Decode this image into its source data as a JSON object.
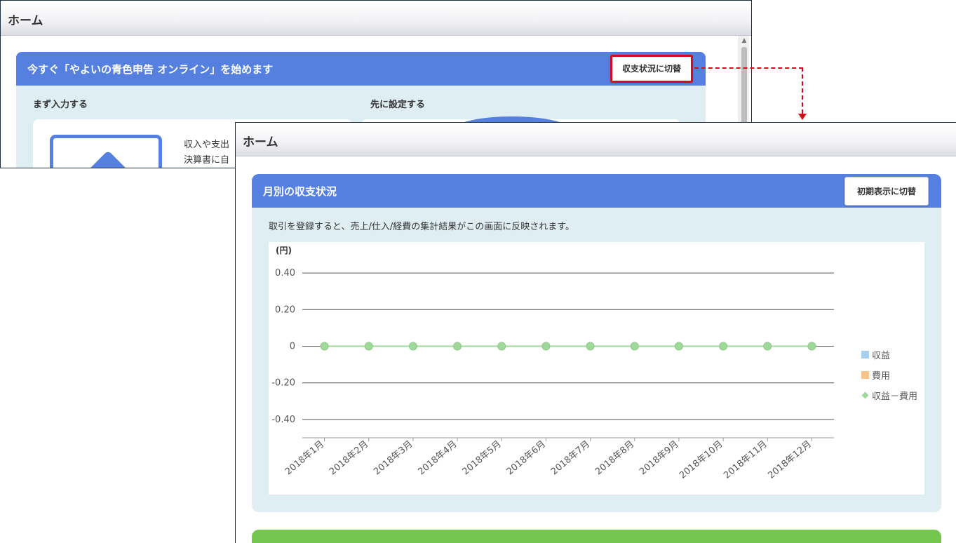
{
  "back_window": {
    "title": "ホーム",
    "card_title": "今すぐ「やよいの青色申告 オンライン」を始めます",
    "switch_label": "収支状況に切替",
    "left_subheading": "まず入力する",
    "right_subheading": "先に設定する",
    "text_line1": "収入や支出",
    "text_line2": "決算書に自"
  },
  "front_window": {
    "title": "ホーム",
    "card_title": "月別の収支状況",
    "switch_label": "初期表示に切替",
    "description": "取引を登録すると、売上/仕入/経費の集計結果がこの画面に反映されます。"
  },
  "colors": {
    "accent_blue": "#5580e0",
    "highlight_red": "#d60c1c",
    "panel_bg": "#deeef3",
    "green_card": "#75c64f",
    "line_green": "#9fd89a"
  },
  "chart_data": {
    "type": "line",
    "ylabel": "(円)",
    "ylim": [
      -0.5,
      0.5
    ],
    "yticks": [
      0.4,
      0.2,
      0,
      -0.2,
      -0.4
    ],
    "ytick_labels": [
      "0.40",
      "0.20",
      "0",
      "-0.20",
      "-0.40"
    ],
    "categories": [
      "2018年1月",
      "2018年2月",
      "2018年3月",
      "2018年4月",
      "2018年5月",
      "2018年6月",
      "2018年7月",
      "2018年8月",
      "2018年9月",
      "2018年10月",
      "2018年11月",
      "2018年12月"
    ],
    "series": [
      {
        "name": "収益",
        "type": "bar",
        "color": "#a9cfef",
        "values": [
          0,
          0,
          0,
          0,
          0,
          0,
          0,
          0,
          0,
          0,
          0,
          0
        ]
      },
      {
        "name": "費用",
        "type": "bar",
        "color": "#f7c48a",
        "values": [
          0,
          0,
          0,
          0,
          0,
          0,
          0,
          0,
          0,
          0,
          0,
          0
        ]
      },
      {
        "name": "収益－費用",
        "type": "line",
        "color": "#9fd89a",
        "values": [
          0,
          0,
          0,
          0,
          0,
          0,
          0,
          0,
          0,
          0,
          0,
          0
        ]
      }
    ],
    "grid": true,
    "legend_position": "right"
  }
}
